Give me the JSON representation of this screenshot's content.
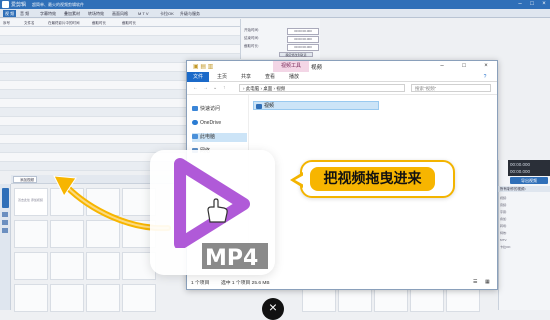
{
  "app": {
    "title": "爱剪辑",
    "subtitle": "超简单、最火的视频剪辑软件",
    "menu": [
      "视 频",
      "音 频",
      "字幕特效",
      "叠加素材",
      "转场特效",
      "画面风格",
      "M T V",
      "卡拉OK",
      "升级与服务"
    ],
    "list_headers": [
      "序号",
      "文件名",
      "在最终影片中的时间",
      "截取时长",
      "截取时长"
    ],
    "props": {
      "labels": [
        "开始时间:",
        "结束时间:",
        "截取时长:"
      ],
      "values": [
        "00:00:00.000",
        "00:00:00.000",
        "00:00:00.000"
      ],
      "button": "确定修改到轨道"
    },
    "tab_add_video": "添加视频",
    "placeholder_thumb": "双击此处\n添加视频",
    "timer": [
      "00:00.000",
      "00:00.000"
    ],
    "export_button": "导出视频",
    "right_head": "所有制作的视频：",
    "right_lines": [
      "视频:",
      "音频:",
      "字幕:",
      "叠加:",
      "转场:",
      "特效:",
      "MTV:",
      "卡拉OK:"
    ]
  },
  "explorer": {
    "tools_label": "视频工具",
    "window_title": "视频",
    "ribbon_tabs": [
      "文件",
      "主页",
      "共享",
      "查看",
      "播放"
    ],
    "breadcrumb": "› 此电脑 › 桌面 › 视频",
    "search_placeholder": "搜索\"视频\"",
    "nav": [
      "快速访问",
      "OneDrive",
      "此电脑",
      "网络"
    ],
    "file_name": "视频",
    "status_count": "1 个项目",
    "status_selected": "选中 1 个项目  25.6 MB"
  },
  "overlay": {
    "format_label": "MP4",
    "instruction": "把视频拖曳进来",
    "colors": {
      "accent": "#f7b500",
      "brand": "#2f6fb8",
      "play": "#b05ad8"
    }
  }
}
